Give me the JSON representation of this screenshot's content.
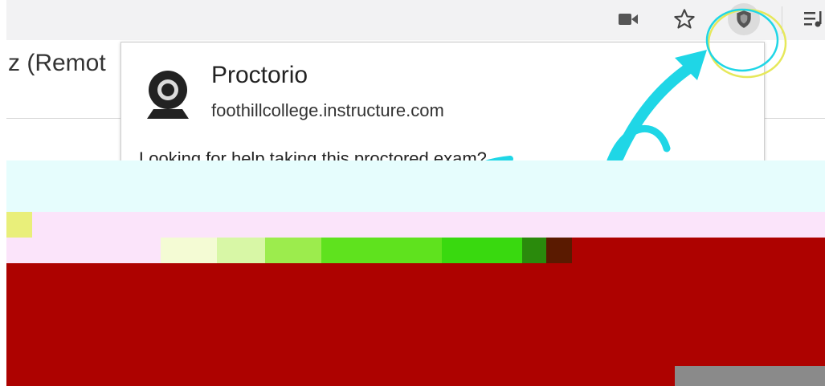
{
  "page": {
    "title_fragment": "z (Remot"
  },
  "toolbar": {
    "icons": [
      "video-camera-icon",
      "star-icon",
      "proctorio-shield-icon",
      "media-queue-icon"
    ]
  },
  "popup": {
    "extension_name": "Proctorio",
    "domain": "foothillcollege.instructure.com",
    "help_text": "Looking for help taking this proctored exam?"
  },
  "colors": {
    "toolbar_bg": "#f2f2f3",
    "annotation_cyan": "#1fd6e6",
    "annotation_yellow": "#e6e85a",
    "glitch_red": "#ad0200",
    "glitch_green": "#39d90f"
  }
}
